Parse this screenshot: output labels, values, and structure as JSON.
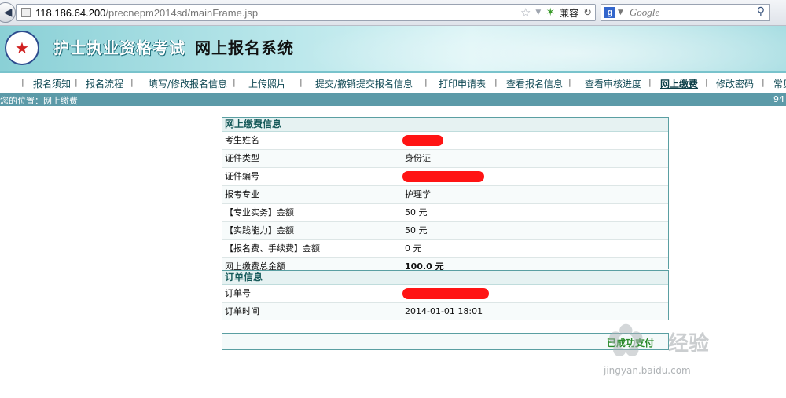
{
  "browser": {
    "url_host": "118.186.64.200",
    "url_path": "/precnepm2014sd/mainFrame.jsp",
    "compat_label": "兼容",
    "search_placeholder": "Google",
    "search_engine_letter": "g"
  },
  "header": {
    "title": "护士执业资格考试",
    "subtitle": "网上报名系统"
  },
  "nav": {
    "items": [
      {
        "label": "报名须知"
      },
      {
        "label": "报名流程"
      },
      {
        "label": "填写/修改报名信息"
      },
      {
        "label": "上传照片"
      },
      {
        "label": "提交/撤销提交报名信息"
      },
      {
        "label": "打印申请表"
      },
      {
        "label": "查看报名信息"
      },
      {
        "label": "查看审核进度"
      },
      {
        "label": "网上缴费"
      },
      {
        "label": "修改密码"
      },
      {
        "label": "常见"
      }
    ],
    "active_index": 8
  },
  "location": {
    "label": "您的位置：网上缴费",
    "right_text": "94"
  },
  "payment": {
    "title": "网上缴费信息",
    "rows": [
      {
        "label": "考生姓名",
        "value": ""
      },
      {
        "label": "证件类型",
        "value": "身份证"
      },
      {
        "label": "证件编号",
        "value": ""
      },
      {
        "label": "报考专业",
        "value": "护理学"
      },
      {
        "label": "【专业实务】金额",
        "value": "50 元"
      },
      {
        "label": "【实践能力】金额",
        "value": "50 元"
      },
      {
        "label": "【报名费、手续费】金额",
        "value": "0 元"
      },
      {
        "label": "网上缴费总金额",
        "value": "100.0 元"
      }
    ]
  },
  "order": {
    "title": "订单信息",
    "rows": [
      {
        "label": "订单号",
        "value": ""
      },
      {
        "label": "订单时间",
        "value": "2014-01-01 18:01"
      }
    ]
  },
  "status": {
    "text": "已成功支付"
  },
  "watermark": {
    "brand": "经验",
    "url": "jingyan.baidu.com"
  },
  "colors": {
    "accent": "#5c9aa8",
    "panel_border": "#5a9fa2",
    "redaction": "#ff1414",
    "status_green": "#2a8a2a"
  }
}
